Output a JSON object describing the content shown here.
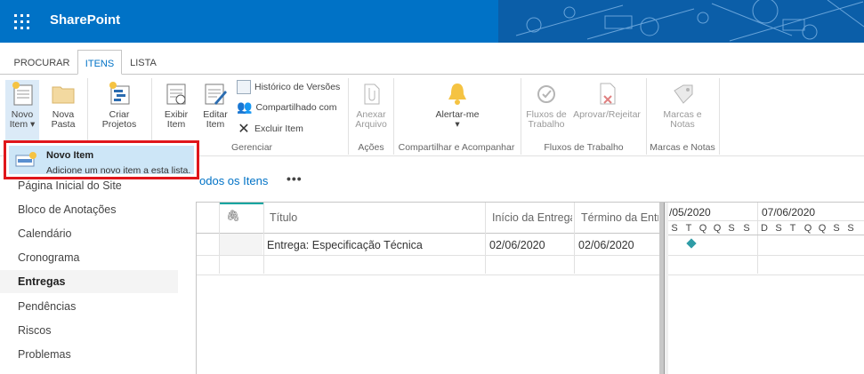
{
  "suite": {
    "brand": "SharePoint"
  },
  "tabs": [
    {
      "label": "PROCURAR"
    },
    {
      "label": "ITENS"
    },
    {
      "label": "LISTA"
    }
  ],
  "ribbon": {
    "novo_item_1": "Novo",
    "novo_item_2": "Item",
    "nova_pasta_1": "Nova",
    "nova_pasta_2": "Pasta",
    "criar_projetos_1": "Criar",
    "criar_projetos_2": "Projetos",
    "exibir_item_1": "Exibir",
    "exibir_item_2": "Item",
    "editar_item_1": "Editar",
    "editar_item_2": "Item",
    "historico": "Histórico de Versões",
    "compartilhado": "Compartilhado com",
    "excluir": "Excluir Item",
    "gerenciar": "Gerenciar",
    "anexar_1": "Anexar",
    "anexar_2": "Arquivo",
    "acoes": "Ações",
    "alertar": "Alertar-me",
    "compartilhar_grupo": "Compartilhar e Acompanhar",
    "fluxos_1": "Fluxos de",
    "fluxos_2": "Trabalho",
    "aprovar": "Aprovar/Rejeitar",
    "fluxos_grupo": "Fluxos de Trabalho",
    "marcas_1": "Marcas e",
    "marcas_2": "Notas",
    "marcas_grupo": "Marcas e Notas"
  },
  "dropdown": {
    "title": "Novo Item",
    "description": "Adicione um novo item a esta lista."
  },
  "view": {
    "label": "odos os Itens",
    "more": "•••"
  },
  "nav": [
    {
      "label": "Página Inicial do Site"
    },
    {
      "label": "Bloco de Anotações"
    },
    {
      "label": "Calendário"
    },
    {
      "label": "Cronograma"
    },
    {
      "label": "Entregas"
    },
    {
      "label": "Pendências"
    },
    {
      "label": "Riscos"
    },
    {
      "label": "Problemas"
    }
  ],
  "grid": {
    "headers": {
      "titulo": "Título",
      "inicio": "Início da Entrega",
      "termino": "Término da Entrega"
    },
    "rows": [
      {
        "titulo": "Entrega: Especificação Técnica",
        "inicio": "02/06/2020",
        "termino": "02/06/2020"
      }
    ]
  },
  "gantt": {
    "week1": "/05/2020",
    "week2": "07/06/2020",
    "days": [
      "S",
      "T",
      "Q",
      "Q",
      "S",
      "S",
      "D",
      "S",
      "T",
      "Q",
      "Q",
      "S",
      "S"
    ]
  },
  "colors": {
    "brand_blue": "#0072c6",
    "highlight_red": "#e0161b",
    "diamond": "#2e9ca6"
  }
}
